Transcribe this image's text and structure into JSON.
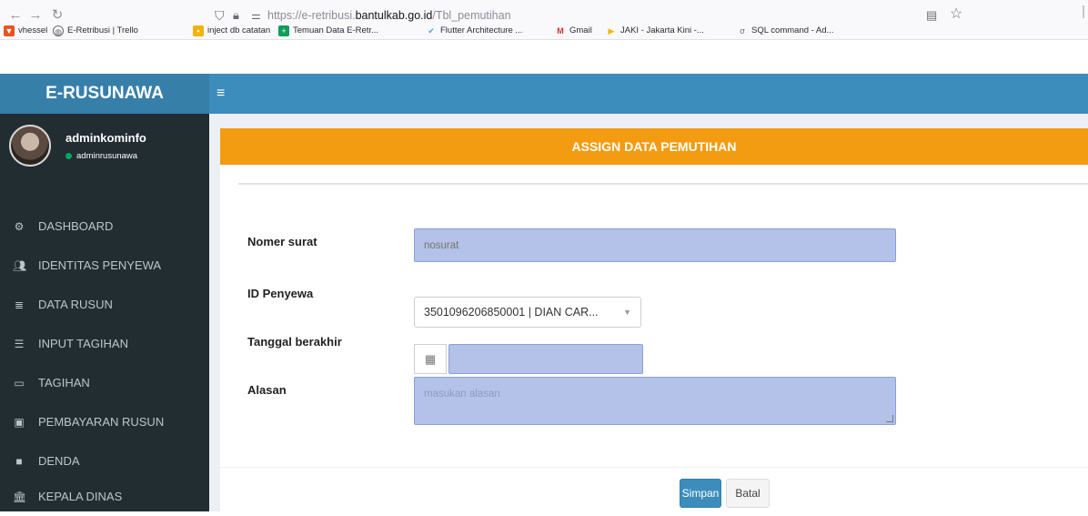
{
  "browser": {
    "url_prefix": "https://e-retribusi.",
    "url_domain": "bantulkab.go.id",
    "url_path": "/Tbl_pemutihan",
    "bookmarks": [
      {
        "label": "vhessel",
        "color": "#e8541e"
      },
      {
        "label": "E-Retribusi | Trello",
        "color": "#6b6b76"
      },
      {
        "label": "inject db catatan",
        "color": "#f4b400"
      },
      {
        "label": "Temuan Data E-Retr...",
        "color": "#0f9d58"
      },
      {
        "label": "Flutter Architecture ...",
        "color": "#42a5f5"
      },
      {
        "label": "Gmail",
        "color": "#d93025"
      },
      {
        "label": "JAKI - Jakarta Kini -...",
        "color": "#f4b400"
      },
      {
        "label": "SQL command - Ad...",
        "color": "#6b6b76"
      }
    ]
  },
  "app": {
    "brand": "E-RUSUNAWA",
    "accent": "#3c8dbc",
    "user": {
      "name": "adminkominfo",
      "role": "adminrusunawa"
    }
  },
  "sidebar": {
    "items": [
      {
        "label": "DASHBOARD",
        "icon": "dashboard-icon"
      },
      {
        "label": "IDENTITAS PENYEWA",
        "icon": "users-icon"
      },
      {
        "label": "DATA RUSUN",
        "icon": "database-icon"
      },
      {
        "label": "INPUT TAGIHAN",
        "icon": "list-icon"
      },
      {
        "label": "TAGIHAN",
        "icon": "card-icon"
      },
      {
        "label": "PEMBAYARAN RUSUN",
        "icon": "money-icon"
      },
      {
        "label": "DENDA",
        "icon": "square-icon"
      },
      {
        "label": "KEPALA DINAS",
        "icon": "building-icon"
      }
    ]
  },
  "form": {
    "title": "ASSIGN DATA PEMUTIHAN",
    "header_color": "#f39c12",
    "nomer_surat_label": "Nomer surat",
    "nomer_surat_placeholder": "nosurat",
    "id_penyewa_label": "ID Penyewa",
    "id_penyewa_value": "3501096206850001 | DIAN CAR...",
    "tanggal_label": "Tanggal berakhir",
    "alasan_label": "Alasan",
    "alasan_placeholder": "masukan alasan",
    "save_label": "Simpan",
    "cancel_label": "Batal"
  }
}
